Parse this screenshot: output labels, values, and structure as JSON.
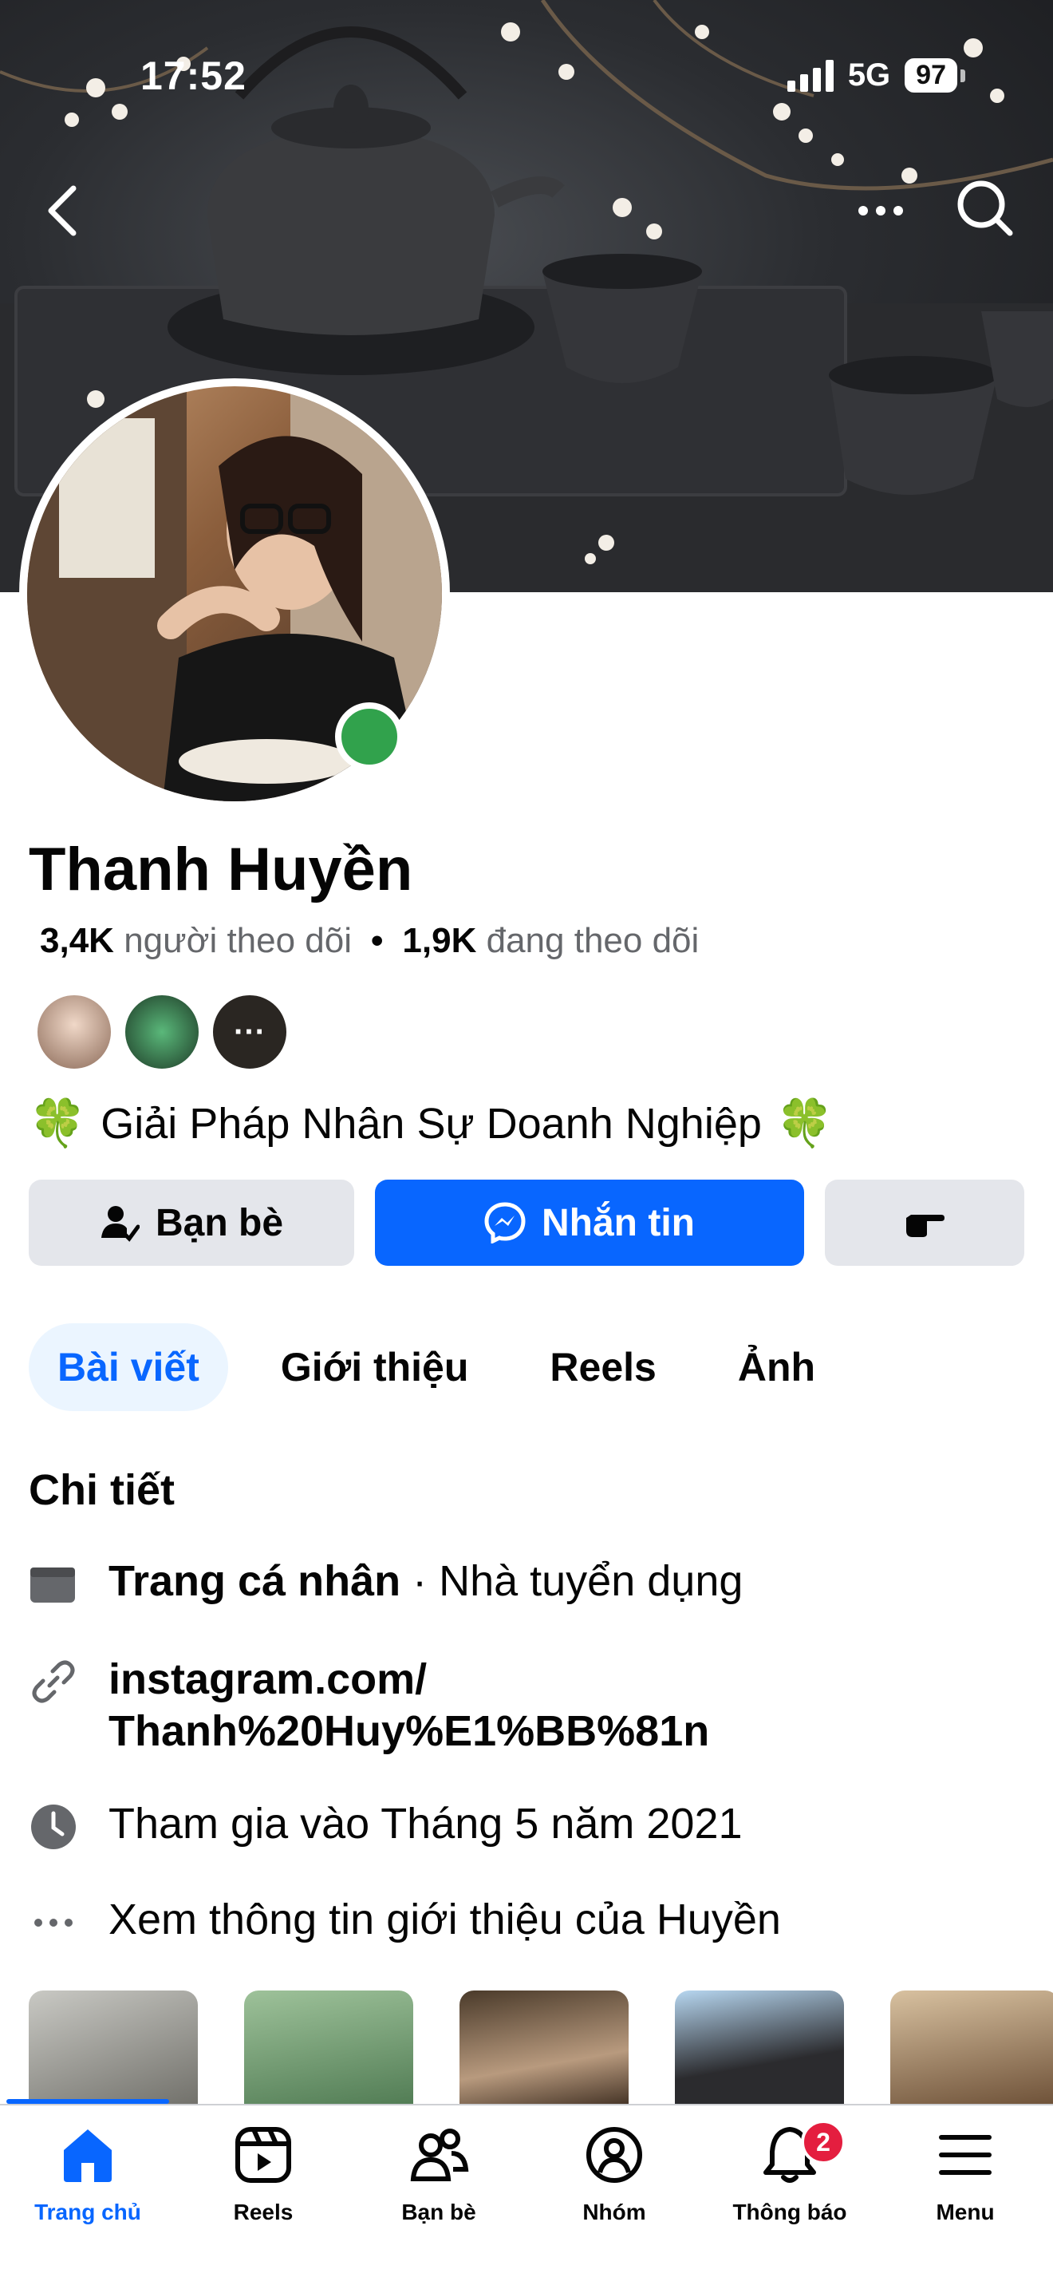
{
  "status_bar": {
    "time": "17:52",
    "network": "5G",
    "battery": "97"
  },
  "profile": {
    "name": "Thanh Huyền",
    "followers_count": "3,4K",
    "followers_label": "người theo dõi",
    "following_count": "1,9K",
    "following_label": "đang theo dõi",
    "separator": "•",
    "mutual_more": "···",
    "bio_emoji": "🍀",
    "bio": "Giải Pháp Nhân Sự Doanh Nghiệp"
  },
  "actions": {
    "friends_label": "Bạn bè",
    "message_label": "Nhắn tin"
  },
  "tabs": [
    {
      "label": "Bài viết",
      "active": true
    },
    {
      "label": "Giới thiệu",
      "active": false
    },
    {
      "label": "Reels",
      "active": false
    },
    {
      "label": "Ảnh",
      "active": false
    }
  ],
  "details": {
    "title": "Chi tiết",
    "page_type_bold": "Trang cá nhân",
    "page_type_rest": " · Nhà tuyển dụng",
    "link_line1": "instagram.com/",
    "link_line2": "Thanh%20Huy%E1%BB%81n",
    "joined": "Tham gia vào Tháng 5 năm 2021",
    "see_more": "Xem thông tin giới thiệu của Huyền"
  },
  "bottom_nav": [
    {
      "label": "Trang chủ",
      "icon": "home-icon",
      "active": true
    },
    {
      "label": "Reels",
      "icon": "reels-icon",
      "active": false
    },
    {
      "label": "Bạn bè",
      "icon": "friends-icon",
      "active": false
    },
    {
      "label": "Nhóm",
      "icon": "groups-icon",
      "active": false
    },
    {
      "label": "Thông báo",
      "icon": "bell-icon",
      "active": false,
      "badge": "2"
    },
    {
      "label": "Menu",
      "icon": "menu-icon",
      "active": false
    }
  ],
  "colors": {
    "accent": "#0866ff",
    "online": "#31a24c",
    "badge": "#e41e3f"
  }
}
